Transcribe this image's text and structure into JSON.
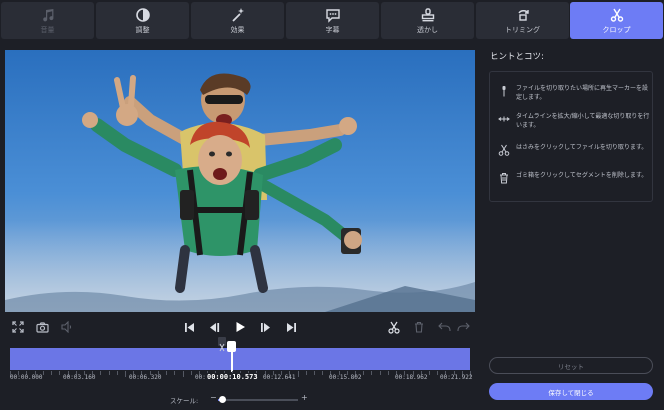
{
  "toolbar": {
    "tabs": [
      {
        "label": "音量",
        "icon": "music-note-icon",
        "state": "disabled"
      },
      {
        "label": "調整",
        "icon": "contrast-icon",
        "state": "normal"
      },
      {
        "label": "効果",
        "icon": "magic-wand-icon",
        "state": "normal"
      },
      {
        "label": "字幕",
        "icon": "speech-bubble-icon",
        "state": "normal"
      },
      {
        "label": "透かし",
        "icon": "stamp-icon",
        "state": "normal"
      },
      {
        "label": "トリミング",
        "icon": "crop-rotate-icon",
        "state": "normal"
      },
      {
        "label": "クロップ",
        "icon": "scissors-icon",
        "state": "active"
      }
    ]
  },
  "preview": {
    "scene": "tandem skydivers in free fall above clouds"
  },
  "controls": {
    "left": [
      "fullscreen-icon",
      "camera-icon",
      "speaker-icon"
    ],
    "center": [
      "skip-back-icon",
      "frame-back-icon",
      "play-icon",
      "frame-forward-icon",
      "skip-forward-icon"
    ],
    "right": [
      "scissors-icon",
      "trash-icon",
      "undo-icon",
      "redo-icon"
    ]
  },
  "timeline": {
    "current_time": "00:00:10.573",
    "ticks": [
      "00:00.000",
      "00:03.160",
      "00:06.320",
      "00:09.481",
      "00:12.641",
      "00:15.802",
      "00:18.962",
      "00:21.922"
    ],
    "playhead_fraction": 0.482
  },
  "scale": {
    "label": "スケール:",
    "minus": "−",
    "plus": "+",
    "level": 0.06
  },
  "hints": {
    "title": "ヒントとコツ:",
    "items": [
      {
        "icon": "pin-icon",
        "text": "ファイルを切り取りたい場所に再生マーカーを設定します。"
      },
      {
        "icon": "expand-arrows-icon",
        "text": "タイムラインを拡大/縮小して最適な切り取りを行います。"
      },
      {
        "icon": "scissors-icon",
        "text": "はさみをクリックしてファイルを切り取ります。"
      },
      {
        "icon": "trash-icon",
        "text": "ゴミ箱をクリックしてセグメントを削除します。"
      }
    ]
  },
  "buttons": {
    "reset": "リセット",
    "save": "保存して閉じる"
  },
  "colors": {
    "accent": "#6d7cf5",
    "background": "#1d1f26",
    "track": "#6b76e6"
  }
}
